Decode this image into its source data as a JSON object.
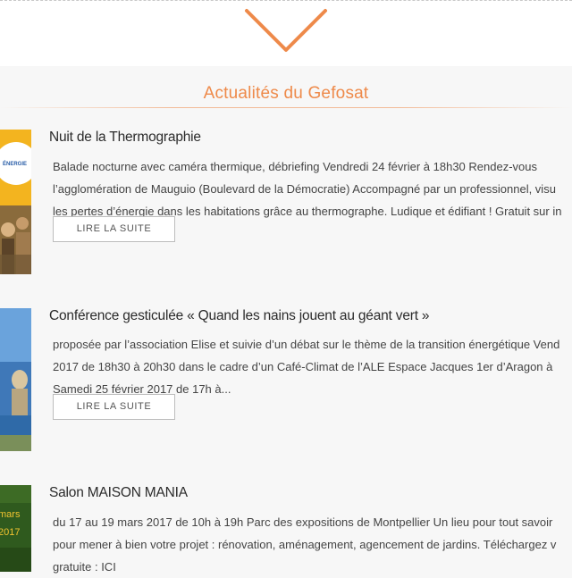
{
  "section": {
    "title": "Actualités du Gefosat"
  },
  "articles": [
    {
      "title": "Nuit de la Thermographie",
      "excerpt_lines": [
        "Balade nocturne avec caméra thermique, débriefing Vendredi 24 février à 18h30 Rendez-vous",
        "l’agglomération de Mauguio (Boulevard de la Démocratie) Accompagné par un professionnel, visu",
        "les pertes d’énergie dans les habitations grâce au thermographe. Ludique et édifiant ! Gratuit sur in"
      ],
      "read_more": "LIRE LA SUITE",
      "thumb_text": "ÉNERGIE"
    },
    {
      "title": "Conférence gesticulée « Quand les nains jouent au géant vert »",
      "excerpt_lines": [
        "proposée par l’association Elise et suivie d’un débat sur le thème de la transition énergétique   Vend",
        "2017 de 18h30 à 20h30 dans le cadre d’un Café-Climat de l’ALE Espace Jacques 1er d’Aragon à",
        "Samedi 25 février 2017 de 17h à..."
      ],
      "read_more": "LIRE LA SUITE"
    },
    {
      "title": "Salon MAISON MANIA",
      "excerpt_lines": [
        "du 17 au 19 mars 2017 de 10h à 19h Parc des expositions de Montpellier Un lieu pour tout savoir",
        "pour mener à bien votre projet : rénovation, aménagement, agencement de jardins. Téléchargez v",
        "gratuite : ICI"
      ],
      "thumb_text_1": "mars",
      "thumb_text_2": "2017"
    }
  ],
  "colors": {
    "accent": "#ee8a4a",
    "background": "#f7f7f7"
  },
  "icons": {
    "scroll_down": "chevron-down-icon"
  }
}
